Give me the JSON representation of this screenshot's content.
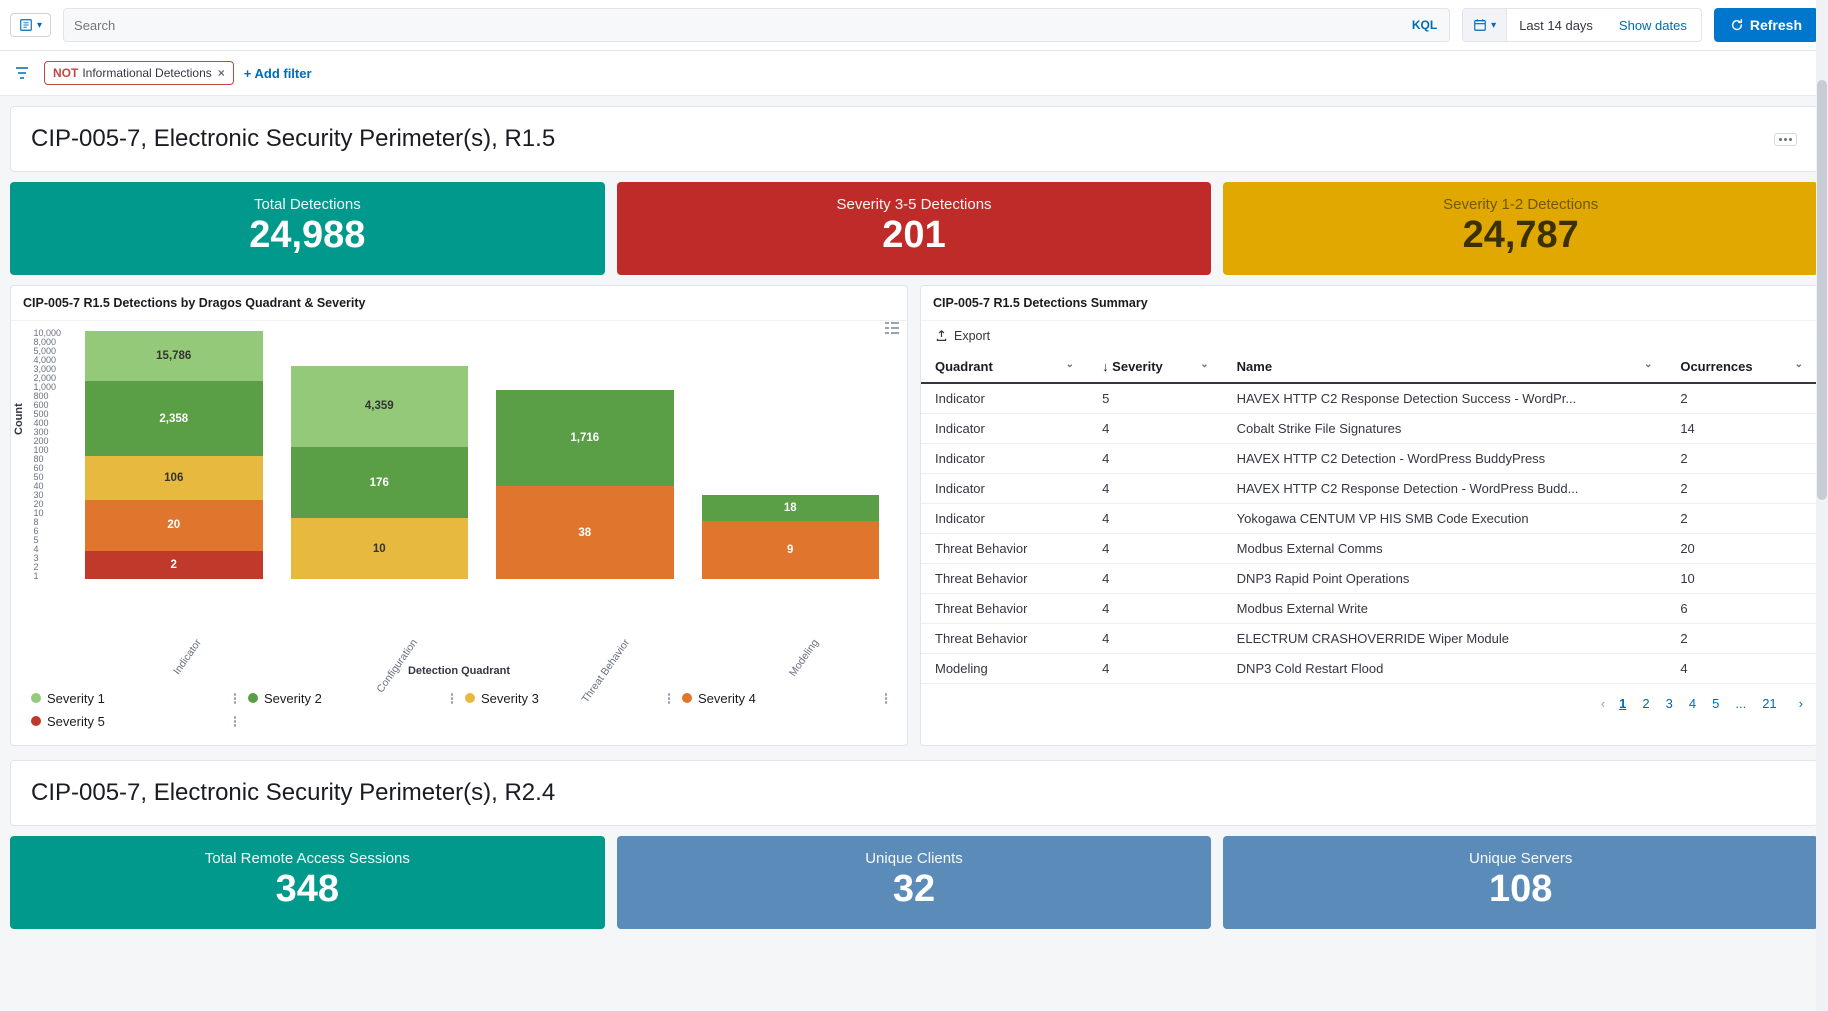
{
  "search": {
    "placeholder": "Search",
    "kql": "KQL"
  },
  "date": {
    "value": "Last 14 days",
    "show_dates": "Show dates"
  },
  "refresh": "Refresh",
  "filter": {
    "negation": "NOT",
    "text": "Informational Detections",
    "add": "+ Add filter"
  },
  "sections": {
    "r15": {
      "title": "CIP-005-7, Electronic Security Perimeter(s), R1.5"
    },
    "r24": {
      "title": "CIP-005-7, Electronic Security Perimeter(s), R2.4"
    }
  },
  "kpis": {
    "total": {
      "label": "Total Detections",
      "value": "24,988"
    },
    "sev35": {
      "label": "Severity 3-5 Detections",
      "value": "201"
    },
    "sev12": {
      "label": "Severity 1-2 Detections",
      "value": "24,787"
    },
    "sessions": {
      "label": "Total Remote Access Sessions",
      "value": "348"
    },
    "clients": {
      "label": "Unique Clients",
      "value": "32"
    },
    "servers": {
      "label": "Unique Servers",
      "value": "108"
    }
  },
  "chart": {
    "title": "CIP-005-7 R1.5 Detections by Dragos Quadrant & Severity",
    "ylabel": "Count",
    "xlabel": "Detection Quadrant",
    "yticks": [
      "10,000",
      "8,000",
      "5,000",
      "4,000",
      "3,000",
      "2,000",
      "1,000",
      "800",
      "600",
      "500",
      "400",
      "300",
      "200",
      "100",
      "80",
      "60",
      "50",
      "40",
      "30",
      "20",
      "10",
      "8",
      "6",
      "5",
      "4",
      "3",
      "2",
      "1"
    ],
    "legend": [
      "Severity 1",
      "Severity 2",
      "Severity 3",
      "Severity 4",
      "Severity 5"
    ]
  },
  "chart_data": {
    "type": "bar",
    "xlabel": "Detection Quadrant",
    "ylabel": "Count",
    "yscale": "log",
    "categories": [
      "Indicator",
      "Configuration",
      "Threat Behavior",
      "Modeling"
    ],
    "series": [
      {
        "name": "Severity 1",
        "values": [
          15786,
          4359,
          null,
          null
        ]
      },
      {
        "name": "Severity 2",
        "values": [
          2358,
          176,
          1716,
          18
        ]
      },
      {
        "name": "Severity 3",
        "values": [
          106,
          10,
          null,
          null
        ]
      },
      {
        "name": "Severity 4",
        "values": [
          20,
          null,
          38,
          9
        ]
      },
      {
        "name": "Severity 5",
        "values": [
          2,
          null,
          null,
          null
        ]
      }
    ],
    "title": "CIP-005-7 R1.5 Detections by Dragos Quadrant & Severity"
  },
  "table": {
    "title": "CIP-005-7 R1.5 Detections Summary",
    "export": "Export",
    "columns": [
      "Quadrant",
      "Severity",
      "Name",
      "Ocurrences"
    ],
    "rows": [
      {
        "q": "Indicator",
        "s": "5",
        "n": "HAVEX HTTP C2 Response Detection Success - WordPr...",
        "o": "2"
      },
      {
        "q": "Indicator",
        "s": "4",
        "n": "Cobalt Strike File Signatures",
        "o": "14"
      },
      {
        "q": "Indicator",
        "s": "4",
        "n": "HAVEX HTTP C2 Detection - WordPress BuddyPress",
        "o": "2"
      },
      {
        "q": "Indicator",
        "s": "4",
        "n": "HAVEX HTTP C2 Response Detection - WordPress Budd...",
        "o": "2"
      },
      {
        "q": "Indicator",
        "s": "4",
        "n": "Yokogawa CENTUM VP HIS SMB Code Execution",
        "o": "2"
      },
      {
        "q": "Threat Behavior",
        "s": "4",
        "n": "Modbus External Comms",
        "o": "20"
      },
      {
        "q": "Threat Behavior",
        "s": "4",
        "n": "DNP3 Rapid Point Operations",
        "o": "10"
      },
      {
        "q": "Threat Behavior",
        "s": "4",
        "n": "Modbus External Write",
        "o": "6"
      },
      {
        "q": "Threat Behavior",
        "s": "4",
        "n": "ELECTRUM CRASHOVERRIDE Wiper Module",
        "o": "2"
      },
      {
        "q": "Modeling",
        "s": "4",
        "n": "DNP3 Cold Restart Flood",
        "o": "4"
      }
    ],
    "pager": {
      "pages": [
        "1",
        "2",
        "3",
        "4",
        "5",
        "...",
        "21"
      ]
    }
  }
}
